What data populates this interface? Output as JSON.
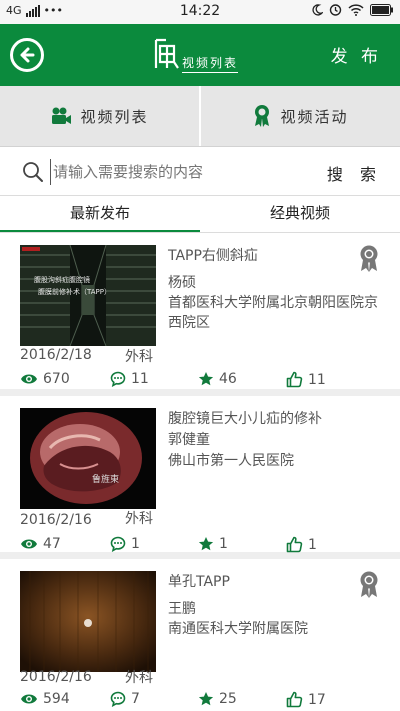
{
  "statusbar": {
    "network": "4G",
    "dots": "•••",
    "time": "14:22",
    "battery": ""
  },
  "header": {
    "logo_title": "视频列表",
    "publish": "发 布"
  },
  "tabs": {
    "video_list": "视频列表",
    "video_events": "视频活动"
  },
  "search": {
    "placeholder": "请输入需要搜索的内容",
    "button": "搜 索"
  },
  "category_tabs": {
    "latest": "最新发布",
    "classic": "经典视频"
  },
  "videos": [
    {
      "title": "TAPP右侧斜疝",
      "author": "杨硕",
      "org": "首都医科大学附属北京朝阳医院京西院区",
      "date": "2016/2/18",
      "dept": "外科",
      "views": "670",
      "comments": "11",
      "favorites": "46",
      "likes": "11",
      "award": true,
      "thumb_caption_1": "腹股沟斜疝腹腔镜",
      "thumb_caption_2": "腹膜前修补术（TAPP）"
    },
    {
      "title": "腹腔镜巨大小儿疝的修补",
      "author": "郭健童",
      "org": "佛山市第一人民医院",
      "date": "2016/2/16",
      "dept": "外科",
      "views": "47",
      "comments": "1",
      "favorites": "1",
      "likes": "1",
      "award": false,
      "thumb_caption_1": "鲁旌東"
    },
    {
      "title": "单孔TAPP",
      "author": "王鹏",
      "org": "南通医科大学附属医院",
      "date": "2016/2/16",
      "dept": "外科",
      "views": "594",
      "comments": "7",
      "favorites": "25",
      "likes": "17",
      "award": true
    }
  ],
  "colors": {
    "brand": "#0b8a3d",
    "icon_green": "#117a3c",
    "award_gray": "#777777"
  }
}
